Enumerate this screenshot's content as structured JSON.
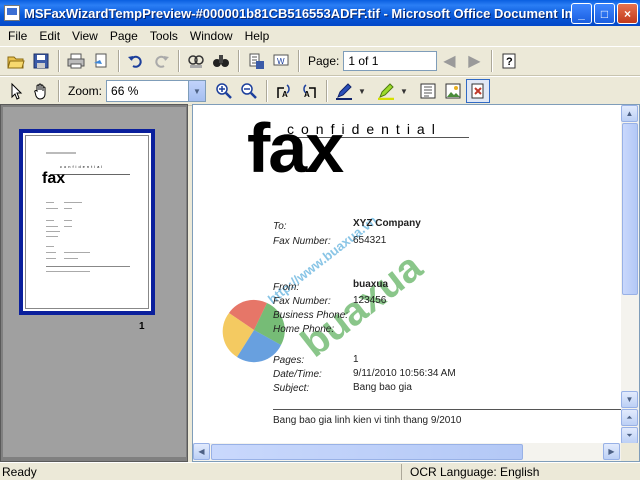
{
  "window": {
    "title": "MSFaxWizardTempPreview-#000001b81CB516553ADFF.tif - Microsoft Office Document Imaging",
    "minimize": "_",
    "maximize": "□",
    "close": "×"
  },
  "menu": [
    "File",
    "Edit",
    "View",
    "Page",
    "Tools",
    "Window",
    "Help"
  ],
  "toolbar": {
    "page_label": "Page:",
    "page_value": "1 of 1",
    "zoom_label": "Zoom:",
    "zoom_value": "66 %"
  },
  "thumbnail": {
    "page_number": "1",
    "fax_word": "fax",
    "conf_word": "confidential"
  },
  "document": {
    "confidential": "confidential",
    "fax": "fax",
    "to_label": "To:",
    "to_value": "XYZ Company",
    "faxnum1_label": "Fax Number:",
    "faxnum1_value": "654321",
    "from_label": "From:",
    "from_value": "buaxua",
    "faxnum2_label": "Fax Number:",
    "faxnum2_value": "123456",
    "business_label": "Business Phone:",
    "home_label": "Home Phone:",
    "pages_label": "Pages:",
    "pages_value": "1",
    "datetime_label": "Date/Time:",
    "datetime_value": "9/11/2010 10:56:34 AM",
    "subject_label": "Subject:",
    "subject_value": "Bang bao gia",
    "body": "Bang bao gia linh kien vi tinh thang 9/2010",
    "watermark_url": "http://www.buaxua.vn",
    "watermark_brand": "buaxua"
  },
  "status": {
    "left": "Ready",
    "right": "OCR Language: English"
  }
}
